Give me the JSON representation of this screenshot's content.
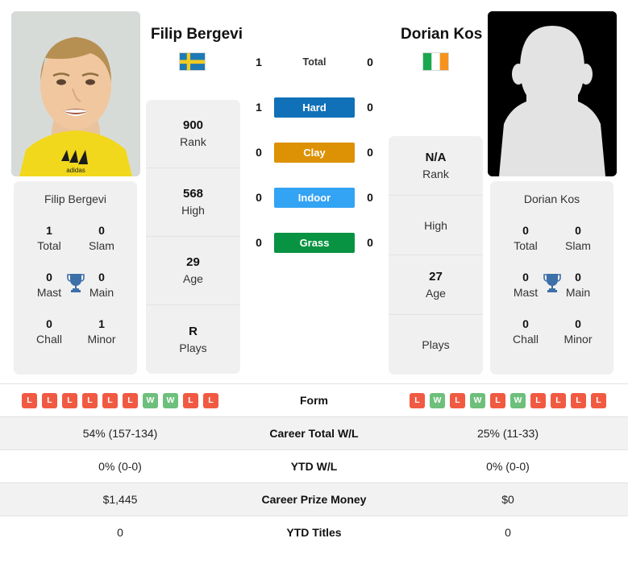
{
  "players": {
    "left": {
      "name": "Filip Bergevi",
      "country": "sweden",
      "photo_type": "portrait-photo",
      "rank": "900",
      "rank_label": "Rank",
      "high": "568",
      "high_label": "High",
      "age": "29",
      "age_label": "Age",
      "plays": "R",
      "plays_label": "Plays",
      "titles_name": "Filip Bergevi",
      "titles": [
        {
          "value": "1",
          "label": "Total"
        },
        {
          "value": "0",
          "label": "Slam"
        },
        {
          "value": "0",
          "label": "Mast"
        },
        {
          "value": "0",
          "label": "Main"
        },
        {
          "value": "0",
          "label": "Chall"
        },
        {
          "value": "1",
          "label": "Minor"
        }
      ],
      "form": [
        "L",
        "L",
        "L",
        "L",
        "L",
        "L",
        "W",
        "W",
        "L",
        "L"
      ],
      "career_wl": "54% (157-134)",
      "ytd_wl": "0% (0-0)",
      "career_prize": "$1,445",
      "ytd_titles": "0"
    },
    "right": {
      "name": "Dorian Kos",
      "country": "ireland",
      "photo_type": "silhouette-placeholder",
      "rank": "N/A",
      "rank_label": "Rank",
      "high": "",
      "high_label": "High",
      "age": "27",
      "age_label": "Age",
      "plays": "",
      "plays_label": "Plays",
      "titles_name": "Dorian Kos",
      "titles": [
        {
          "value": "0",
          "label": "Total"
        },
        {
          "value": "0",
          "label": "Slam"
        },
        {
          "value": "0",
          "label": "Mast"
        },
        {
          "value": "0",
          "label": "Main"
        },
        {
          "value": "0",
          "label": "Chall"
        },
        {
          "value": "0",
          "label": "Minor"
        }
      ],
      "form": [
        "L",
        "W",
        "L",
        "W",
        "L",
        "W",
        "L",
        "L",
        "L",
        "L"
      ],
      "career_wl": "25% (11-33)",
      "ytd_wl": "0% (0-0)",
      "career_prize": "$0",
      "ytd_titles": "0"
    }
  },
  "surfaces": [
    {
      "label": "Total",
      "left": "1",
      "right": "0",
      "color": "none",
      "style": "plain"
    },
    {
      "label": "Hard",
      "left": "1",
      "right": "0",
      "color": "#1071b8",
      "style": "badge"
    },
    {
      "label": "Clay",
      "left": "0",
      "right": "0",
      "color": "#dd9104",
      "style": "badge"
    },
    {
      "label": "Indoor",
      "left": "0",
      "right": "0",
      "color": "#33a3f4",
      "style": "badge"
    },
    {
      "label": "Grass",
      "left": "0",
      "right": "0",
      "color": "#089342",
      "style": "badge"
    }
  ],
  "table_rows": [
    {
      "label": "Form",
      "type": "form",
      "left": "",
      "right": "",
      "shade": false
    },
    {
      "label": "Career Total W/L",
      "type": "text",
      "left": "54% (157-134)",
      "right": "25% (11-33)",
      "shade": true
    },
    {
      "label": "YTD W/L",
      "type": "text",
      "left": "0% (0-0)",
      "right": "0% (0-0)",
      "shade": false
    },
    {
      "label": "Career Prize Money",
      "type": "text",
      "left": "$1,445",
      "right": "$0",
      "shade": true
    },
    {
      "label": "YTD Titles",
      "type": "text",
      "left": "0",
      "right": "0",
      "shade": false
    }
  ],
  "colors": {
    "win": "#6dbf7b",
    "loss": "#f15a42",
    "panel": "#f0f0f0",
    "row_shade": "#f2f2f2",
    "trophy": "#3d6fa8"
  }
}
